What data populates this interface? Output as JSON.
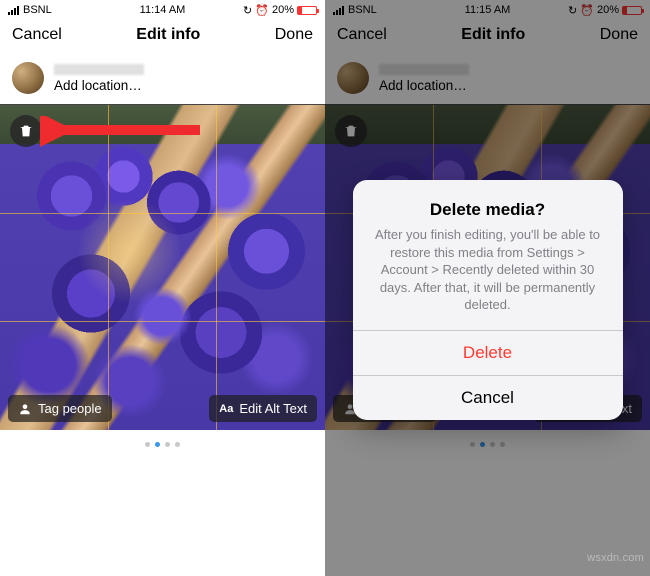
{
  "status": {
    "carrier": "BSNL",
    "time_left": "11:14 AM",
    "time_right": "11:15 AM",
    "battery_pct": "20%",
    "orientation_icon": "orientation-lock-icon",
    "alarm_icon": "alarm-icon"
  },
  "nav": {
    "cancel": "Cancel",
    "title": "Edit info",
    "done": "Done"
  },
  "post_header": {
    "add_location": "Add location…"
  },
  "overlays": {
    "tag_people": "Tag people",
    "edit_alt": "Edit Alt Text",
    "aa_label": "Aa"
  },
  "alert": {
    "title": "Delete media?",
    "message": "After you finish editing, you'll be able to restore this media from Settings > Account > Recently deleted within 30 days. After that, it will be permanently deleted.",
    "delete": "Delete",
    "cancel": "Cancel"
  },
  "carousel": {
    "count": 4,
    "active_index": 1
  },
  "watermark": "wsxdn.com"
}
